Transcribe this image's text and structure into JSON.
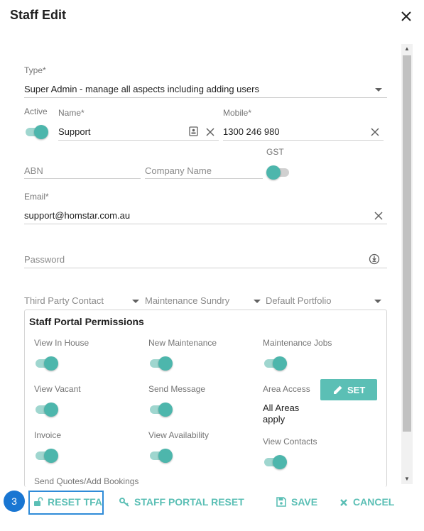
{
  "dialog": {
    "title": "Staff Edit"
  },
  "form": {
    "type_label": "Type*",
    "type_value": "Super Admin - manage all aspects including adding users",
    "active_label": "Active",
    "name_label": "Name*",
    "name_value": "Support",
    "mobile_label": "Mobile*",
    "mobile_value": "1300 246 980",
    "abn_placeholder": "ABN",
    "company_placeholder": "Company Name",
    "gst_label": "GST",
    "email_label": "Email*",
    "email_value": "support@homstar.com.au",
    "password_placeholder": "Password",
    "third_party_placeholder": "Third Party Contact",
    "maintenance_sundry_placeholder": "Maintenance Sundry",
    "default_portfolio_placeholder": "Default Portfolio"
  },
  "permissions": {
    "title": "Staff Portal Permissions",
    "view_in_house": "View In House",
    "new_maintenance": "New Maintenance",
    "maintenance_jobs": "Maintenance Jobs",
    "view_vacant": "View Vacant",
    "send_message": "Send Message",
    "area_access": "Area Access",
    "area_access_value_1": "All Areas",
    "area_access_value_2": "apply",
    "set_label": "SET",
    "invoice": "Invoice",
    "view_availability": "View Availability",
    "view_contacts": "View Contacts",
    "send_quotes": "Send Quotes/Add Bookings"
  },
  "footer": {
    "reset_tfa": "RESET TFA",
    "staff_portal_reset": "STAFF PORTAL RESET",
    "save": "SAVE",
    "cancel": "CANCEL"
  },
  "annotation": {
    "step_number": "3"
  },
  "colors": {
    "accent": "#5bbfb5",
    "highlight": "#2f8bd8",
    "badge": "#1976d2"
  }
}
